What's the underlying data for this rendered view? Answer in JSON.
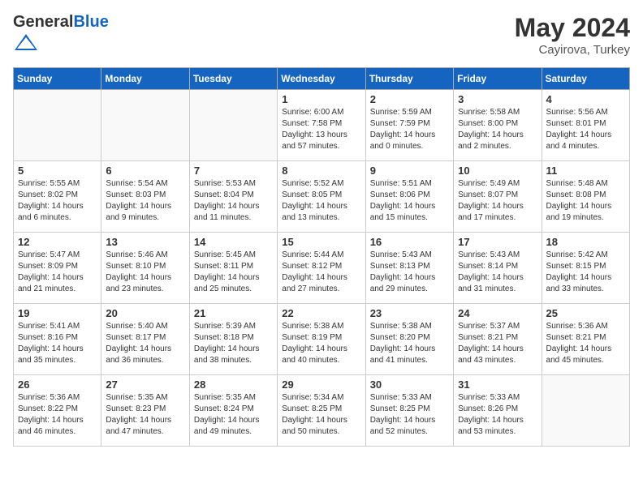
{
  "header": {
    "logo_general": "General",
    "logo_blue": "Blue",
    "title": "May 2024",
    "location": "Cayirova, Turkey"
  },
  "days_of_week": [
    "Sunday",
    "Monday",
    "Tuesday",
    "Wednesday",
    "Thursday",
    "Friday",
    "Saturday"
  ],
  "weeks": [
    [
      {
        "day": "",
        "info": ""
      },
      {
        "day": "",
        "info": ""
      },
      {
        "day": "",
        "info": ""
      },
      {
        "day": "1",
        "info": "Sunrise: 6:00 AM\nSunset: 7:58 PM\nDaylight: 13 hours\nand 57 minutes."
      },
      {
        "day": "2",
        "info": "Sunrise: 5:59 AM\nSunset: 7:59 PM\nDaylight: 14 hours\nand 0 minutes."
      },
      {
        "day": "3",
        "info": "Sunrise: 5:58 AM\nSunset: 8:00 PM\nDaylight: 14 hours\nand 2 minutes."
      },
      {
        "day": "4",
        "info": "Sunrise: 5:56 AM\nSunset: 8:01 PM\nDaylight: 14 hours\nand 4 minutes."
      }
    ],
    [
      {
        "day": "5",
        "info": "Sunrise: 5:55 AM\nSunset: 8:02 PM\nDaylight: 14 hours\nand 6 minutes."
      },
      {
        "day": "6",
        "info": "Sunrise: 5:54 AM\nSunset: 8:03 PM\nDaylight: 14 hours\nand 9 minutes."
      },
      {
        "day": "7",
        "info": "Sunrise: 5:53 AM\nSunset: 8:04 PM\nDaylight: 14 hours\nand 11 minutes."
      },
      {
        "day": "8",
        "info": "Sunrise: 5:52 AM\nSunset: 8:05 PM\nDaylight: 14 hours\nand 13 minutes."
      },
      {
        "day": "9",
        "info": "Sunrise: 5:51 AM\nSunset: 8:06 PM\nDaylight: 14 hours\nand 15 minutes."
      },
      {
        "day": "10",
        "info": "Sunrise: 5:49 AM\nSunset: 8:07 PM\nDaylight: 14 hours\nand 17 minutes."
      },
      {
        "day": "11",
        "info": "Sunrise: 5:48 AM\nSunset: 8:08 PM\nDaylight: 14 hours\nand 19 minutes."
      }
    ],
    [
      {
        "day": "12",
        "info": "Sunrise: 5:47 AM\nSunset: 8:09 PM\nDaylight: 14 hours\nand 21 minutes."
      },
      {
        "day": "13",
        "info": "Sunrise: 5:46 AM\nSunset: 8:10 PM\nDaylight: 14 hours\nand 23 minutes."
      },
      {
        "day": "14",
        "info": "Sunrise: 5:45 AM\nSunset: 8:11 PM\nDaylight: 14 hours\nand 25 minutes."
      },
      {
        "day": "15",
        "info": "Sunrise: 5:44 AM\nSunset: 8:12 PM\nDaylight: 14 hours\nand 27 minutes."
      },
      {
        "day": "16",
        "info": "Sunrise: 5:43 AM\nSunset: 8:13 PM\nDaylight: 14 hours\nand 29 minutes."
      },
      {
        "day": "17",
        "info": "Sunrise: 5:43 AM\nSunset: 8:14 PM\nDaylight: 14 hours\nand 31 minutes."
      },
      {
        "day": "18",
        "info": "Sunrise: 5:42 AM\nSunset: 8:15 PM\nDaylight: 14 hours\nand 33 minutes."
      }
    ],
    [
      {
        "day": "19",
        "info": "Sunrise: 5:41 AM\nSunset: 8:16 PM\nDaylight: 14 hours\nand 35 minutes."
      },
      {
        "day": "20",
        "info": "Sunrise: 5:40 AM\nSunset: 8:17 PM\nDaylight: 14 hours\nand 36 minutes."
      },
      {
        "day": "21",
        "info": "Sunrise: 5:39 AM\nSunset: 8:18 PM\nDaylight: 14 hours\nand 38 minutes."
      },
      {
        "day": "22",
        "info": "Sunrise: 5:38 AM\nSunset: 8:19 PM\nDaylight: 14 hours\nand 40 minutes."
      },
      {
        "day": "23",
        "info": "Sunrise: 5:38 AM\nSunset: 8:20 PM\nDaylight: 14 hours\nand 41 minutes."
      },
      {
        "day": "24",
        "info": "Sunrise: 5:37 AM\nSunset: 8:21 PM\nDaylight: 14 hours\nand 43 minutes."
      },
      {
        "day": "25",
        "info": "Sunrise: 5:36 AM\nSunset: 8:21 PM\nDaylight: 14 hours\nand 45 minutes."
      }
    ],
    [
      {
        "day": "26",
        "info": "Sunrise: 5:36 AM\nSunset: 8:22 PM\nDaylight: 14 hours\nand 46 minutes."
      },
      {
        "day": "27",
        "info": "Sunrise: 5:35 AM\nSunset: 8:23 PM\nDaylight: 14 hours\nand 47 minutes."
      },
      {
        "day": "28",
        "info": "Sunrise: 5:35 AM\nSunset: 8:24 PM\nDaylight: 14 hours\nand 49 minutes."
      },
      {
        "day": "29",
        "info": "Sunrise: 5:34 AM\nSunset: 8:25 PM\nDaylight: 14 hours\nand 50 minutes."
      },
      {
        "day": "30",
        "info": "Sunrise: 5:33 AM\nSunset: 8:25 PM\nDaylight: 14 hours\nand 52 minutes."
      },
      {
        "day": "31",
        "info": "Sunrise: 5:33 AM\nSunset: 8:26 PM\nDaylight: 14 hours\nand 53 minutes."
      },
      {
        "day": "",
        "info": ""
      }
    ]
  ]
}
